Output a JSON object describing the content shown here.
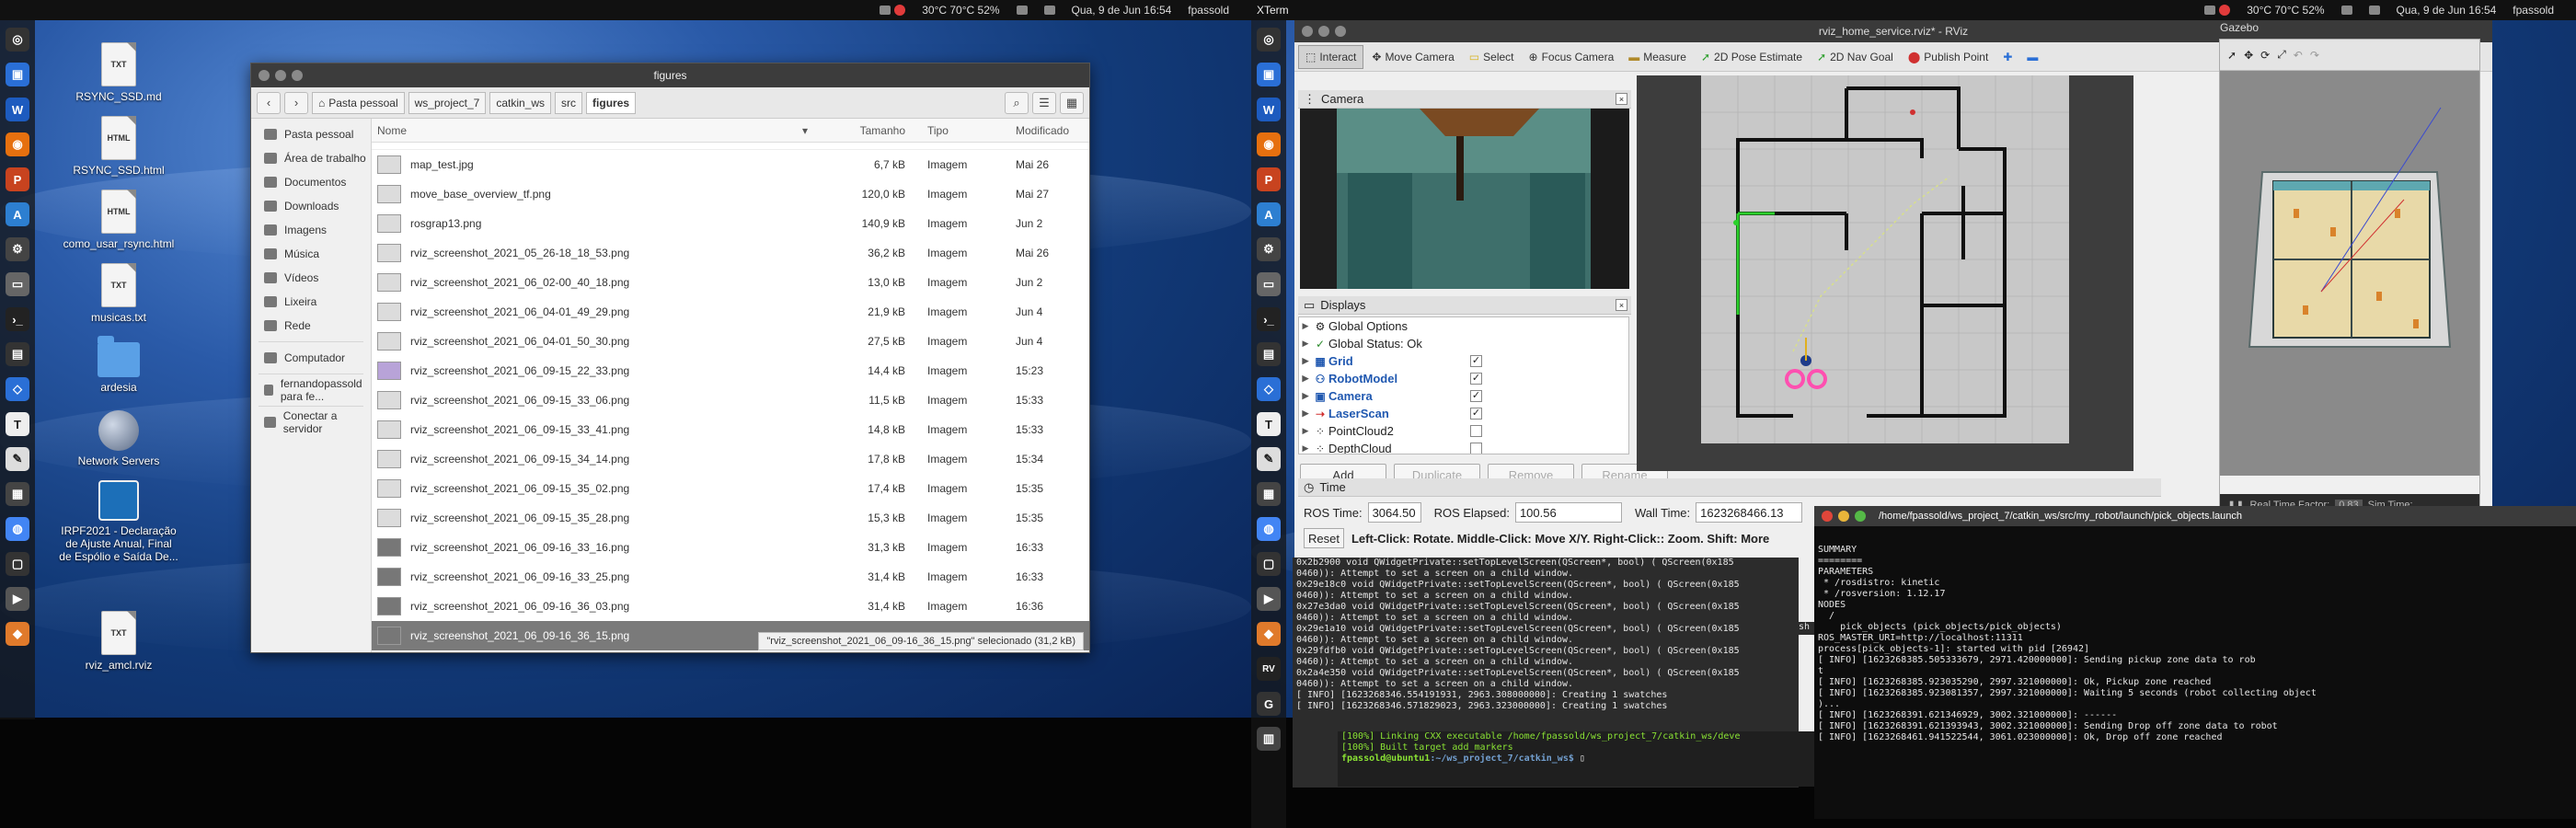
{
  "left_screen": {
    "topbar": {
      "weather": "30°C 70°C 52%",
      "date": "Qua, 9 de Jun 16:54",
      "user": "fpassold"
    },
    "desktop_icons": [
      {
        "label": "RSYNC_SSD.md",
        "kind": "TXT"
      },
      {
        "label": "RSYNC_SSD.html",
        "kind": "HTML"
      },
      {
        "label": "como_usar_rsync.html",
        "kind": "HTML"
      },
      {
        "label": "musicas.txt",
        "kind": "TXT"
      },
      {
        "label": "ardesia",
        "kind": "folder"
      },
      {
        "label": "Network Servers",
        "kind": "globe"
      },
      {
        "label": "IRPF2021 - Declaração de Ajuste Anual, Final de Espólio e Saída De...",
        "kind": "badge"
      },
      {
        "label": "rviz_amcl.rviz",
        "kind": "TXT"
      }
    ],
    "files_window": {
      "title": "figures",
      "breadcrumbs": [
        "Pasta pessoal",
        "ws_project_7",
        "catkin_ws",
        "src",
        "figures"
      ],
      "sidebar": [
        "Pasta pessoal",
        "Área de trabalho",
        "Documentos",
        "Downloads",
        "Imagens",
        "Música",
        "Vídeos",
        "Lixeira",
        "Rede",
        "Computador",
        "fernandopassold para fe...",
        "Conectar a servidor"
      ],
      "columns": {
        "name": "Nome",
        "size": "Tamanho",
        "type": "Tipo",
        "modified": "Modificado"
      },
      "rows": [
        {
          "name": "map_test.jpg",
          "size": "6,7 kB",
          "type": "Imagem",
          "modified": "Mai 26"
        },
        {
          "name": "move_base_overview_tf.png",
          "size": "120,0 kB",
          "type": "Imagem",
          "modified": "Mai 27"
        },
        {
          "name": "rosgrap13.png",
          "size": "140,9 kB",
          "type": "Imagem",
          "modified": "Jun 2"
        },
        {
          "name": "rviz_screenshot_2021_05_26-18_18_53.png",
          "size": "36,2 kB",
          "type": "Imagem",
          "modified": "Mai 26"
        },
        {
          "name": "rviz_screenshot_2021_06_02-00_40_18.png",
          "size": "13,0 kB",
          "type": "Imagem",
          "modified": "Jun 2"
        },
        {
          "name": "rviz_screenshot_2021_06_04-01_49_29.png",
          "size": "21,9 kB",
          "type": "Imagem",
          "modified": "Jun 4"
        },
        {
          "name": "rviz_screenshot_2021_06_04-01_50_30.png",
          "size": "27,5 kB",
          "type": "Imagem",
          "modified": "Jun 4"
        },
        {
          "name": "rviz_screenshot_2021_06_09-15_22_33.png",
          "size": "14,4 kB",
          "type": "Imagem",
          "modified": "15:23"
        },
        {
          "name": "rviz_screenshot_2021_06_09-15_33_06.png",
          "size": "11,5 kB",
          "type": "Imagem",
          "modified": "15:33"
        },
        {
          "name": "rviz_screenshot_2021_06_09-15_33_41.png",
          "size": "14,8 kB",
          "type": "Imagem",
          "modified": "15:33"
        },
        {
          "name": "rviz_screenshot_2021_06_09-15_34_14.png",
          "size": "17,8 kB",
          "type": "Imagem",
          "modified": "15:34"
        },
        {
          "name": "rviz_screenshot_2021_06_09-15_35_02.png",
          "size": "17,4 kB",
          "type": "Imagem",
          "modified": "15:35"
        },
        {
          "name": "rviz_screenshot_2021_06_09-15_35_28.png",
          "size": "15,3 kB",
          "type": "Imagem",
          "modified": "15:35"
        },
        {
          "name": "rviz_screenshot_2021_06_09-16_33_16.png",
          "size": "31,3 kB",
          "type": "Imagem",
          "modified": "16:33"
        },
        {
          "name": "rviz_screenshot_2021_06_09-16_33_25.png",
          "size": "31,4 kB",
          "type": "Imagem",
          "modified": "16:33"
        },
        {
          "name": "rviz_screenshot_2021_06_09-16_36_03.png",
          "size": "31,4 kB",
          "type": "Imagem",
          "modified": "16:36"
        },
        {
          "name": "rviz_screenshot_2021_06_09-16_36_15.png",
          "size": "",
          "type": "",
          "modified": ""
        }
      ],
      "selection_status": "\"rviz_screenshot_2021_06_09-16_36_15.png\" selecionado (31,2 kB)"
    }
  },
  "right_screen": {
    "topbar": {
      "app": "XTerm",
      "weather": "30°C 70°C 52%",
      "date": "Qua, 9 de Jun 16:54",
      "user": "fpassold"
    },
    "rviz": {
      "title": "rviz_home_service.rviz* - RViz",
      "tools": [
        "Interact",
        "Move Camera",
        "Select",
        "Focus Camera",
        "Measure",
        "2D Pose Estimate",
        "2D Nav Goal",
        "Publish Point"
      ],
      "camera_panel": "Camera",
      "displays_panel": "Displays",
      "displays": [
        {
          "label": "Global Options",
          "checked": null
        },
        {
          "label": "Global Status: Ok",
          "checked": null
        },
        {
          "label": "Grid",
          "checked": true
        },
        {
          "label": "RobotModel",
          "checked": true
        },
        {
          "label": "Camera",
          "checked": true
        },
        {
          "label": "LaserScan",
          "checked": true
        },
        {
          "label": "PointCloud2",
          "checked": false
        },
        {
          "label": "DepthCloud",
          "checked": false
        }
      ],
      "display_buttons": [
        "Add",
        "Duplicate",
        "Remove",
        "Rename"
      ],
      "time_panel": "Time",
      "ros_time_label": "ROS Time:",
      "ros_time": "3064.50",
      "ros_elapsed_label": "ROS Elapsed:",
      "ros_elapsed": "100.56",
      "wall_time_label": "Wall Time:",
      "wall_time": "1623268466.13",
      "reset": "Reset",
      "hint": "Left-Click: Rotate. Middle-Click: Move X/Y. Right-Click:: Zoom. Shift: More"
    },
    "gazebo": {
      "title": "Gazebo",
      "real_time_factor_label": "Real Time Factor:",
      "real_time_factor": "0.83",
      "sim_time_label": "Sim Time:"
    },
    "terminal_build": {
      "lines": [
        "0x2b2900 void QWidgetPrivate::setTopLevelScreen(QScreen*, bool) ( QScreen(0x185",
        "0460)): Attempt to set a screen on a child window.",
        "0x29e18c0 void QWidgetPrivate::setTopLevelScreen(QScreen*, bool) ( QScreen(0x185",
        "0460)): Attempt to set a screen on a child window.",
        "0x27e3da0 void QWidgetPrivate::setTopLevelScreen(QScreen*, bool) ( QScreen(0x185",
        "0460)): Attempt to set a screen on a child window.",
        "0x29e1a10 void QWidgetPrivate::setTopLevelScreen(QScreen*, bool) ( QScreen(0x185",
        "0460)): Attempt to set a screen on a child window.",
        "0x29fdfb0 void QWidgetPrivate::setTopLevelScreen(QScreen*, bool) ( QScreen(0x185",
        "0460)): Attempt to set a screen on a child window.",
        "0x2a4e350 void QWidgetPrivate::setTopLevelScreen(QScreen*, bool) ( QScreen(0x185",
        "0460)): Attempt to set a screen on a child window.",
        "[ INFO] [1623268346.554191931, 2963.308000000]: Creating 1 swatches",
        "[ INFO] [1623268346.571829023, 2963.323000000]: Creating 1 swatches"
      ],
      "extra_lines": [
        "[100%] Linking CXX executable /home/fpassold/ws_project_7/catkin_ws/deve",
        "[100%] Built target add_markers"
      ],
      "prompt_user": "fpassold@ubuntu1",
      "prompt_path": ":~/ws_project_7/catkin_ws$",
      "side_text": "sh"
    },
    "terminal_launch": {
      "title": "/home/fpassold/ws_project_7/catkin_ws/src/my_robot/launch/pick_objects.launch",
      "lines": [
        "SUMMARY",
        "========",
        "",
        "PARAMETERS",
        " * /rosdistro: kinetic",
        " * /rosversion: 1.12.17",
        "",
        "NODES",
        "  /",
        "    pick_objects (pick_objects/pick_objects)",
        "",
        "ROS_MASTER_URI=http://localhost:11311",
        "",
        "process[pick_objects-1]: started with pid [26942]",
        "[ INFO] [1623268385.505333679, 2971.420000000]: Sending pickup zone data to rob",
        "t",
        "[ INFO] [1623268385.923035290, 2997.321000000]: Ok, Pickup zone reached",
        "[ INFO] [1623268385.923081357, 2997.321000000]: Waiting 5 seconds (robot collecting object",
        ")...",
        "[ INFO] [1623268391.621346929, 3002.321000000]: ------",
        "[ INFO] [1623268391.621393943, 3002.321000000]: Sending Drop off zone data to robot",
        "[ INFO] [1623268461.941522544, 3061.023000000]: Ok, Drop off zone reached"
      ]
    }
  }
}
